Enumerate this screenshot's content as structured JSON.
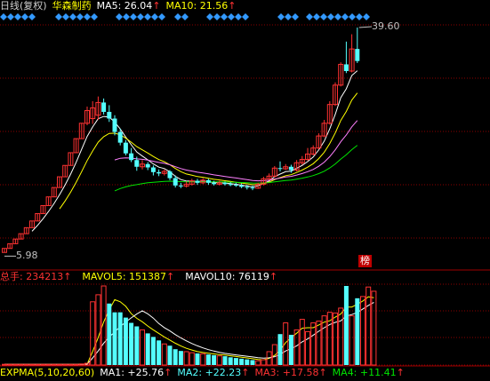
{
  "header": {
    "period": "日线(复权)",
    "stock_name": "华森制药",
    "ma5": "MA5: 26.04",
    "ma10": "MA10: 21.56",
    "arrow": "↑"
  },
  "price_panel": {
    "high_label": "39.60",
    "low_label": "5.98",
    "badge": "榜"
  },
  "volume_header": {
    "total": "总手: 234213",
    "mavol5": "MAVOL5: 151387",
    "mavol10": "MAVOL10: 76119",
    "arrow": "↑"
  },
  "indicator_bar": {
    "name": "EXPMA(5,10,20,60)",
    "ma1": "MA1: +25.76",
    "ma2": "MA2: +22.23",
    "ma3": "MA3: +17.58",
    "ma4": "MA4: +11.41",
    "arrow": "↑"
  },
  "colors": {
    "up": "#ff3232",
    "down": "#54ffff",
    "ma5": "#ffffff",
    "ma10": "#ffff00",
    "ma20": "#ff80ff",
    "ma60": "#00e600",
    "grid": "#8b0000",
    "diamond": "#3399ff"
  },
  "candles": [
    [
      6.0,
      6.6,
      6.0,
      6.6
    ],
    [
      6.6,
      7.3,
      6.6,
      7.3
    ],
    [
      7.3,
      8.0,
      7.3,
      8.0
    ],
    [
      8.0,
      8.8,
      8.0,
      8.8
    ],
    [
      8.8,
      9.7,
      8.8,
      9.7
    ],
    [
      9.7,
      10.7,
      9.7,
      10.7
    ],
    [
      10.7,
      11.8,
      10.7,
      11.8
    ],
    [
      11.8,
      13.0,
      11.8,
      13.0
    ],
    [
      13.0,
      14.3,
      13.0,
      14.3
    ],
    [
      14.3,
      15.7,
      14.3,
      15.7
    ],
    [
      15.7,
      17.3,
      15.7,
      17.3
    ],
    [
      17.3,
      19.0,
      17.3,
      19.0
    ],
    [
      19.0,
      20.9,
      19.0,
      20.9
    ],
    [
      20.9,
      23.0,
      20.9,
      23.0
    ],
    [
      23.0,
      25.3,
      23.0,
      25.3
    ],
    [
      25.3,
      27.2,
      25.0,
      27.8
    ],
    [
      26.0,
      27.6,
      25.2,
      28.6
    ],
    [
      26.5,
      28.4,
      25.8,
      29.3
    ],
    [
      28.4,
      27.0,
      26.6,
      29.0
    ],
    [
      27.0,
      26.0,
      25.5,
      28.0
    ],
    [
      26.0,
      24.0,
      23.5,
      26.5
    ],
    [
      24.0,
      22.4,
      22.0,
      24.5
    ],
    [
      22.4,
      20.8,
      20.5,
      22.8
    ],
    [
      20.8,
      19.8,
      19.5,
      21.6
    ],
    [
      19.8,
      18.8,
      18.2,
      20.3
    ],
    [
      18.8,
      19.2,
      18.4,
      19.8
    ],
    [
      19.2,
      18.7,
      18.3,
      19.5
    ],
    [
      18.7,
      18.0,
      17.5,
      19.0
    ],
    [
      18.0,
      17.8,
      17.4,
      18.4
    ],
    [
      17.8,
      18.1,
      17.5,
      18.4
    ],
    [
      18.1,
      17.1,
      16.8,
      18.3
    ],
    [
      17.1,
      16.0,
      15.7,
      17.5
    ],
    [
      16.0,
      15.9,
      15.6,
      16.4
    ],
    [
      15.9,
      16.2,
      15.7,
      16.6
    ],
    [
      16.2,
      16.7,
      16.0,
      17.0
    ],
    [
      16.7,
      16.4,
      16.1,
      17.0
    ],
    [
      16.4,
      16.8,
      16.2,
      17.1
    ],
    [
      16.8,
      16.4,
      16.1,
      17.0
    ],
    [
      16.4,
      16.2,
      16.0,
      16.7
    ],
    [
      16.2,
      16.4,
      16.0,
      16.7
    ],
    [
      16.4,
      16.2,
      16.0,
      16.6
    ],
    [
      16.2,
      16.1,
      15.9,
      16.5
    ],
    [
      16.1,
      16.0,
      15.8,
      16.4
    ],
    [
      16.0,
      15.8,
      15.6,
      16.3
    ],
    [
      15.8,
      15.7,
      15.4,
      16.1
    ],
    [
      15.7,
      15.6,
      15.3,
      16.0
    ],
    [
      15.6,
      16.2,
      15.5,
      16.4
    ],
    [
      16.2,
      17.0,
      16.0,
      17.3
    ],
    [
      17.0,
      17.4,
      16.8,
      17.8
    ],
    [
      17.4,
      18.6,
      17.2,
      18.9
    ],
    [
      18.6,
      18.5,
      18.1,
      19.6
    ],
    [
      18.5,
      18.8,
      18.3,
      19.2
    ],
    [
      18.8,
      18.3,
      17.9,
      19.1
    ],
    [
      18.3,
      19.4,
      18.1,
      19.8
    ],
    [
      19.4,
      19.9,
      19.1,
      20.4
    ],
    [
      19.9,
      20.7,
      19.7,
      21.6
    ],
    [
      20.7,
      21.6,
      20.5,
      22.0
    ],
    [
      21.6,
      23.4,
      21.4,
      23.8
    ],
    [
      23.4,
      25.3,
      23.2,
      25.8
    ],
    [
      25.3,
      28.1,
      25.1,
      28.6
    ],
    [
      28.1,
      31.0,
      27.9,
      31.4
    ],
    [
      31.0,
      34.1,
      30.8,
      34.4
    ],
    [
      34.1,
      33.1,
      32.8,
      37.5
    ],
    [
      33.1,
      36.4,
      32.9,
      38.6
    ],
    [
      36.4,
      34.6,
      34.3,
      39.6
    ]
  ],
  "volumes": [
    2,
    2,
    2,
    2,
    2,
    2,
    2,
    2,
    2,
    2,
    2,
    2,
    2,
    2,
    3,
    5,
    180,
    200,
    225,
    175,
    150,
    150,
    135,
    120,
    110,
    100,
    90,
    80,
    70,
    60,
    55,
    45,
    40,
    38,
    35,
    33,
    32,
    30,
    28,
    26,
    25,
    22,
    20,
    18,
    16,
    14,
    12,
    15,
    38,
    58,
    88,
    120,
    86,
    100,
    130,
    95,
    120,
    125,
    140,
    150,
    148,
    162,
    225,
    140,
    190,
    195,
    222,
    210
  ],
  "volume_up": [
    1,
    1,
    1,
    1,
    1,
    1,
    1,
    1,
    1,
    1,
    1,
    1,
    1,
    1,
    1,
    1,
    1,
    1,
    1,
    0,
    0,
    0,
    0,
    0,
    0,
    1,
    0,
    0,
    0,
    1,
    0,
    0,
    0,
    1,
    1,
    0,
    1,
    0,
    0,
    1,
    0,
    0,
    0,
    0,
    0,
    0,
    1,
    1,
    1,
    1,
    0,
    1,
    0,
    1,
    1,
    1,
    1,
    1,
    1,
    1,
    1,
    1,
    0,
    1,
    0,
    1,
    1,
    1
  ]
}
